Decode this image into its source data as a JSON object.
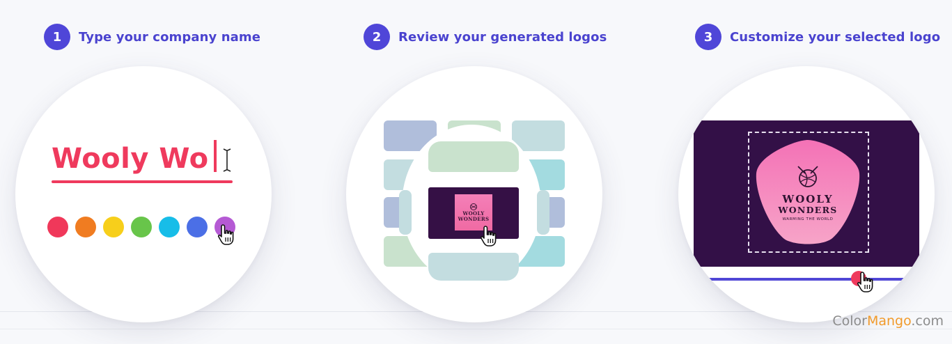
{
  "steps": [
    {
      "number": "1",
      "label": "Type your company name"
    },
    {
      "number": "2",
      "label": "Review your generated logos"
    },
    {
      "number": "3",
      "label": "Customize your selected logo"
    }
  ],
  "panel1": {
    "typed_text": "Wooly Wo",
    "swatch_colors": [
      "#f0385a",
      "#f07c21",
      "#f7cf1b",
      "#68c54a",
      "#17bde8",
      "#4b6fe6",
      "#b55ad4"
    ]
  },
  "panel2": {
    "logo_line1": "WOOLY",
    "logo_line2": "WONDERS"
  },
  "panel3": {
    "logo_title_line1": "WOOLY",
    "logo_title_line2": "WONDERS",
    "logo_tagline": "WARMING THE WORLD",
    "slider_value": 0.75
  },
  "watermark": {
    "part1": "Color",
    "part2": "Mango",
    "part3": ".com"
  },
  "colors": {
    "accent": "#4f46d8",
    "brand_red": "#ef3a5d",
    "panel_dark": "#331047",
    "logo_pink": "#f47fb8"
  }
}
